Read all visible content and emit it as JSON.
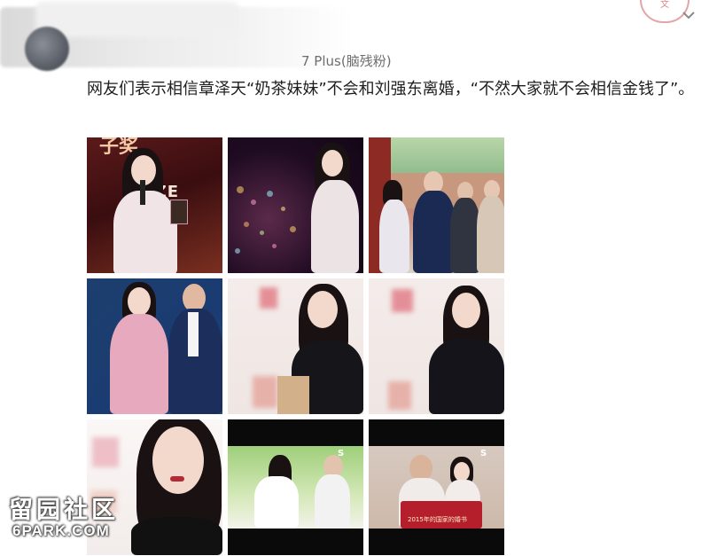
{
  "header": {
    "device_label": "7 Plus(脑残粉)",
    "stamp_text": "文"
  },
  "post": {
    "text": "网友们表示相信章泽天“奶茶妹妹”不会和刘强东离婚，“不然大家就不会相信金钱了”。"
  },
  "images": {
    "tile1_caption": "URE PRIZE",
    "tile1_top_caption": "子奖",
    "tile9_caption": "2015年的国家的婚书",
    "tile9_badge": "S"
  },
  "watermark": {
    "cn": "留园社区",
    "en": "6PARK.COM"
  },
  "colors": {
    "text": "#1e1e1e",
    "device": "#6e6e6e",
    "background": "#ffffff"
  },
  "icons": {
    "menu": "chevron-down-icon",
    "avatar": "avatar"
  }
}
